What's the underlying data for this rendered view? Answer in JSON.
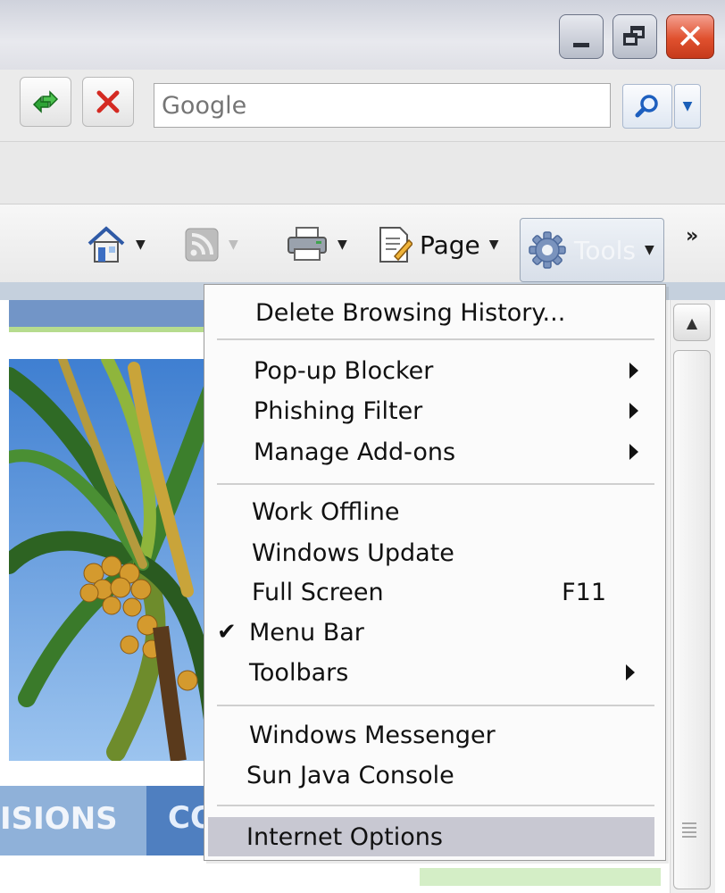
{
  "window": {
    "minimize_icon": "minimize-icon",
    "restore_icon": "restore-icon",
    "close_icon": "close-icon",
    "close_color": "#e0502e"
  },
  "address_bar": {
    "refresh_icon": "refresh-icon",
    "stop_icon": "stop-icon",
    "search_placeholder": "Google",
    "search_icon": "magnifier-icon"
  },
  "command_bar": {
    "home_icon": "home-icon",
    "feeds_icon": "rss-feed-icon",
    "print_icon": "printer-icon",
    "page_label": "Page",
    "tools_label": "Tools",
    "more_label": "»"
  },
  "page_content": {
    "nav_label_1": "ISIONS",
    "nav_label_2": "CO"
  },
  "tools_menu": {
    "items": [
      {
        "label": "Delete Browsing History..."
      },
      {
        "label": "Pop-up Blocker",
        "submenu": true
      },
      {
        "label": "Phishing Filter",
        "submenu": true
      },
      {
        "label": "Manage Add-ons",
        "submenu": true
      },
      {
        "label": "Work Offline"
      },
      {
        "label": "Windows Update"
      },
      {
        "label": "Full Screen",
        "shortcut": "F11"
      },
      {
        "label": "Menu Bar",
        "checked": true
      },
      {
        "label": "Toolbars",
        "submenu": true
      },
      {
        "label": "Windows Messenger"
      },
      {
        "label": "Sun Java Console"
      },
      {
        "label": "Internet Options",
        "highlighted": true
      }
    ]
  }
}
